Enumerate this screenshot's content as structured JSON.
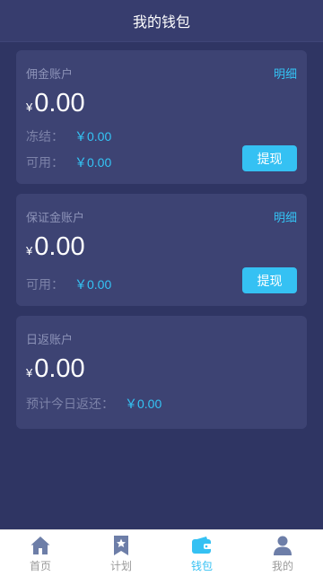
{
  "header": {
    "title": "我的钱包"
  },
  "currency_symbol": "¥",
  "cards": [
    {
      "title": "佣金账户",
      "detail_label": "明细",
      "balance": "0.00",
      "rows": [
        {
          "label": "冻结：",
          "value": "￥0.00"
        },
        {
          "label": "可用：",
          "value": "￥0.00"
        }
      ],
      "withdraw_label": "提现"
    },
    {
      "title": "保证金账户",
      "detail_label": "明细",
      "balance": "0.00",
      "rows": [
        {
          "label": "可用：",
          "value": "￥0.00"
        }
      ],
      "withdraw_label": "提现"
    },
    {
      "title": "日返账户",
      "balance": "0.00",
      "rows": [
        {
          "label": "预计今日返还：",
          "value": "￥0.00"
        }
      ]
    }
  ],
  "tabbar": {
    "items": [
      {
        "label": "首页",
        "icon": "home-icon"
      },
      {
        "label": "计划",
        "icon": "bookmark-star-icon"
      },
      {
        "label": "钱包",
        "icon": "wallet-icon",
        "active": true
      },
      {
        "label": "我的",
        "icon": "user-icon"
      }
    ],
    "active_color": "#35c1f3",
    "inactive_color": "#9a9a9a"
  },
  "colors": {
    "background": "#2f3563",
    "card": "#3d4373",
    "accent": "#34c4f5"
  }
}
